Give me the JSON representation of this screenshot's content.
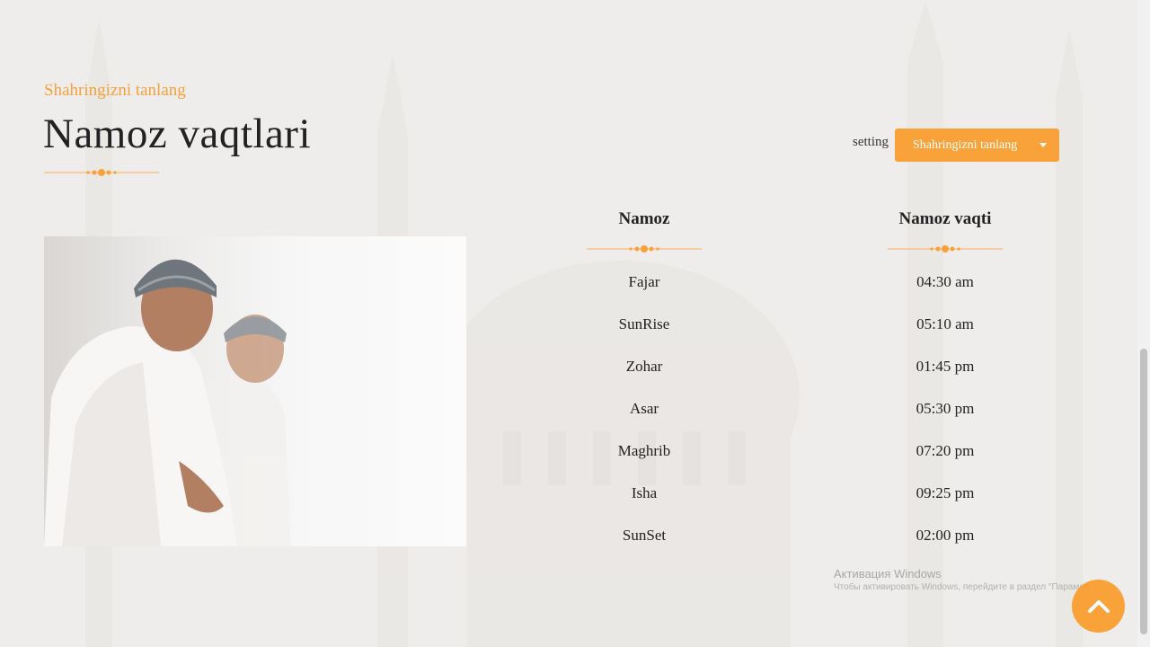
{
  "header": {
    "subtitle": "Shahringizni tanlang",
    "title": "Namoz vaqtlari"
  },
  "settings": {
    "label": "setting",
    "city_select": "Shahringizni tanlang"
  },
  "table": {
    "columns": [
      "Namoz",
      "Namoz vaqti"
    ],
    "rows": [
      {
        "name": "Fajar",
        "time": "04:30 am"
      },
      {
        "name": "SunRise",
        "time": "05:10 am"
      },
      {
        "name": "Zohar",
        "time": "01:45 pm"
      },
      {
        "name": "Asar",
        "time": "05:30 pm"
      },
      {
        "name": "Maghrib",
        "time": "07:20 pm"
      },
      {
        "name": "Isha",
        "time": "09:25 pm"
      },
      {
        "name": "SunSet",
        "time": "02:00 pm"
      }
    ]
  },
  "watermark": {
    "title": "Активация Windows",
    "subtitle": "Чтобы активировать Windows, перейдите в раздел \"Параметры\"."
  },
  "colors": {
    "accent": "#f9a23a",
    "background": "#efedeb",
    "text": "#222222"
  },
  "icons": {
    "scroll_top": "chevron-up-icon",
    "dropdown": "caret-down-icon"
  }
}
